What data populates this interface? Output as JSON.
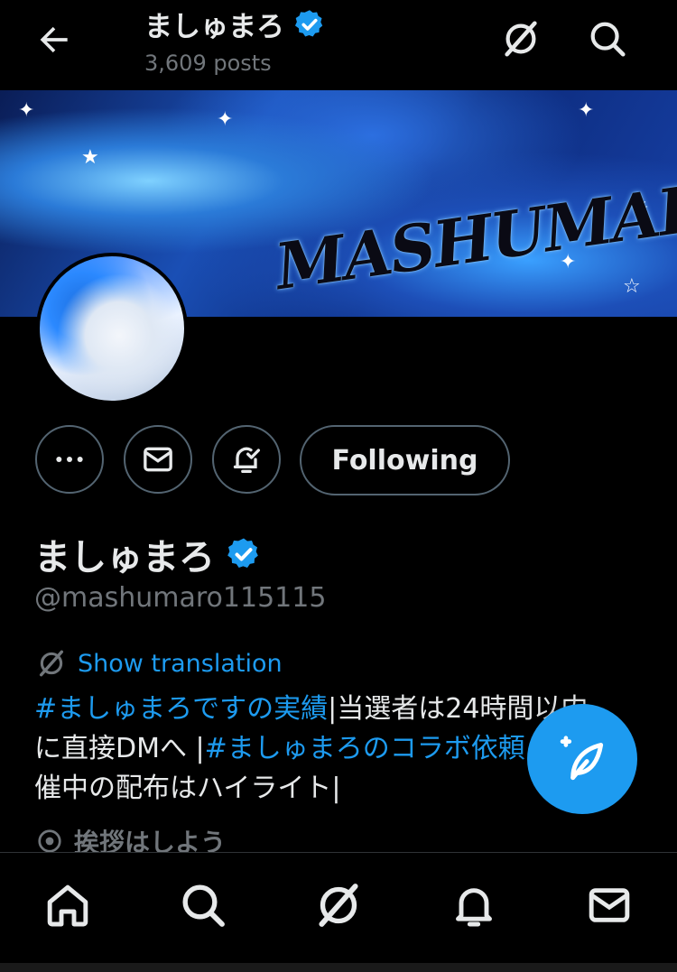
{
  "header": {
    "title": "ましゅまろ",
    "post_count": "3,609 posts",
    "back_icon": "arrow-left-icon",
    "grok_icon": "grok-icon",
    "search_icon": "search-icon"
  },
  "banner": {
    "logo_text": "MASHUMARO"
  },
  "profile": {
    "display_name": "ましゅまろ",
    "handle": "@mashumaro115115",
    "verified": true,
    "actions": {
      "more_icon": "more-icon",
      "message_icon": "mail-icon",
      "notify_icon": "bell-check-icon",
      "following_label": "Following"
    },
    "translate_label": "Show translation",
    "bio": {
      "tag1": "#ましゅまろですの実績",
      "text1": "|当選者は24時間以内",
      "text2": "に直接DMへ |",
      "tag2": "#ましゅまろのコラボ依頼",
      "text3": "催中の配布はハイライト|"
    },
    "location": "挨拶はしよう"
  },
  "fab": {
    "icon": "compose-post-icon"
  },
  "bottom_nav": {
    "items": [
      "home-icon",
      "search-icon",
      "grok-icon",
      "notifications-icon",
      "messages-icon"
    ]
  },
  "colors": {
    "background": "#000000",
    "accent": "#1d9bf0",
    "text": "#e7e9ea",
    "muted": "#71767b"
  }
}
